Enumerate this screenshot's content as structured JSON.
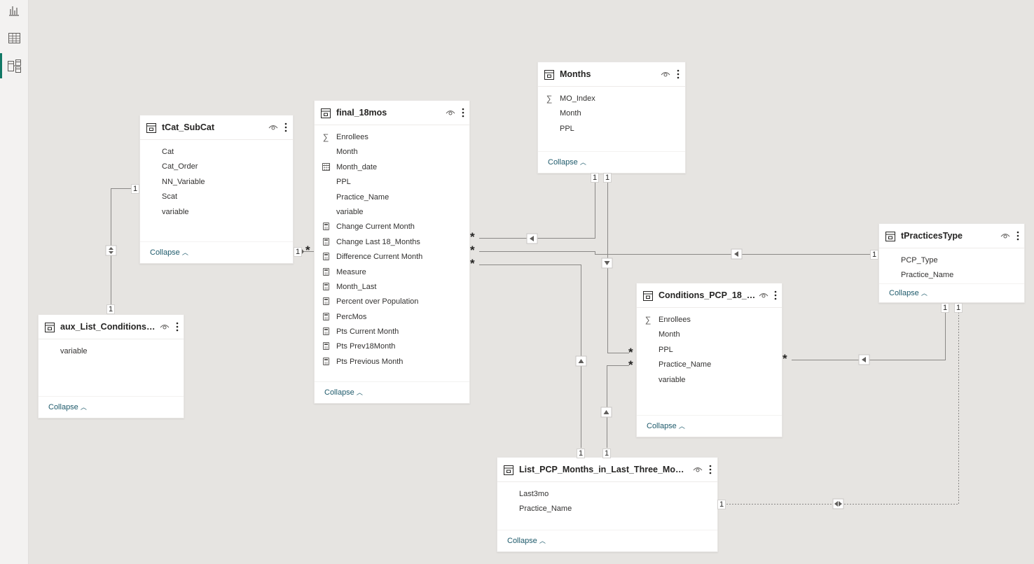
{
  "nav": [
    {
      "name": "report-view",
      "icon": "bar-chart-icon"
    },
    {
      "name": "data-view",
      "icon": "table-grid-icon"
    },
    {
      "name": "model-view",
      "icon": "model-diagram-icon",
      "active": true
    }
  ],
  "accent_color": "#117865",
  "link_color": "#1e5a6b",
  "collapse_label": "Collapse",
  "tables": {
    "tcat": {
      "title": "tCat_SubCat",
      "fields": [
        {
          "name": "Cat",
          "icon": ""
        },
        {
          "name": "Cat_Order",
          "icon": ""
        },
        {
          "name": "NN_Variable",
          "icon": ""
        },
        {
          "name": "Scat",
          "icon": ""
        },
        {
          "name": "variable",
          "icon": ""
        }
      ]
    },
    "aux": {
      "title": "aux_List_Conditions_u...",
      "fields": [
        {
          "name": "variable",
          "icon": ""
        }
      ]
    },
    "final": {
      "title": "final_18mos",
      "fields": [
        {
          "name": "Enrollees",
          "icon": "sigma"
        },
        {
          "name": "Month",
          "icon": ""
        },
        {
          "name": "Month_date",
          "icon": "calendar"
        },
        {
          "name": "PPL",
          "icon": ""
        },
        {
          "name": "Practice_Name",
          "icon": ""
        },
        {
          "name": "variable",
          "icon": ""
        },
        {
          "name": "Change Current Month",
          "icon": "calc"
        },
        {
          "name": "Change Last 18_Months",
          "icon": "calc"
        },
        {
          "name": "Difference Current Month",
          "icon": "calc"
        },
        {
          "name": "Measure",
          "icon": "calc"
        },
        {
          "name": "Month_Last",
          "icon": "calc"
        },
        {
          "name": "Percent over Population",
          "icon": "calc"
        },
        {
          "name": "PercMos",
          "icon": "calc"
        },
        {
          "name": "Pts Current Month",
          "icon": "calc"
        },
        {
          "name": "Pts Prev18Month",
          "icon": "calc"
        },
        {
          "name": "Pts Previous Month",
          "icon": "calc"
        }
      ]
    },
    "months": {
      "title": "Months",
      "fields": [
        {
          "name": "MO_Index",
          "icon": "sigma"
        },
        {
          "name": "Month",
          "icon": ""
        },
        {
          "name": "PPL",
          "icon": ""
        }
      ]
    },
    "conditions": {
      "title": "Conditions_PCP_18_m...",
      "fields": [
        {
          "name": "Enrollees",
          "icon": "sigma"
        },
        {
          "name": "Month",
          "icon": ""
        },
        {
          "name": "PPL",
          "icon": ""
        },
        {
          "name": "Practice_Name",
          "icon": ""
        },
        {
          "name": "variable",
          "icon": ""
        }
      ]
    },
    "ptype": {
      "title": "tPracticesType",
      "fields": [
        {
          "name": "PCP_Type",
          "icon": ""
        },
        {
          "name": "Practice_Name",
          "icon": ""
        }
      ]
    },
    "listpcp": {
      "title": "List_PCP_Months_in_Last_Three_Months",
      "fields": [
        {
          "name": "Last3mo",
          "icon": ""
        },
        {
          "name": "Practice_Name",
          "icon": ""
        }
      ]
    }
  },
  "cardinality": {
    "one": "1",
    "many": "*"
  }
}
